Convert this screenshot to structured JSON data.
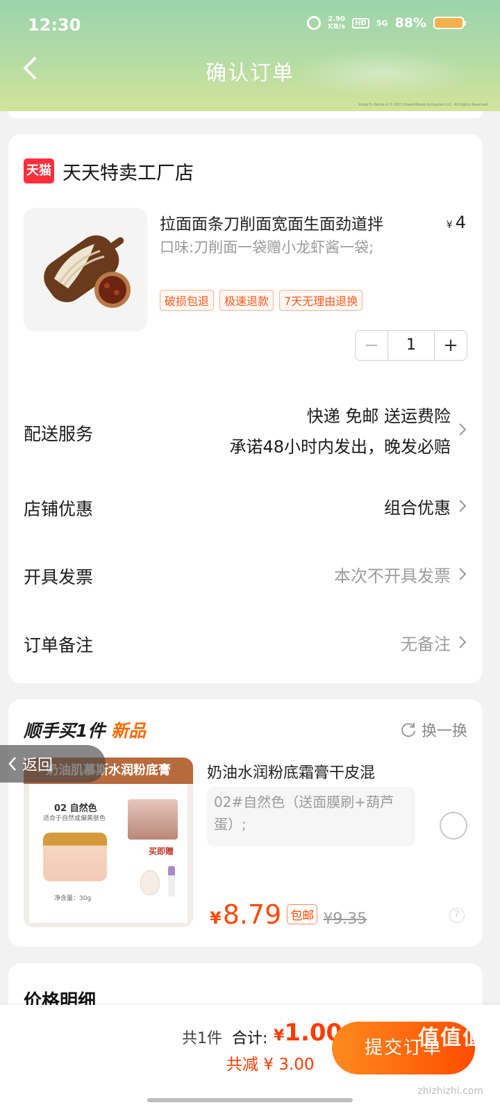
{
  "status_bar": {
    "time": "12:30",
    "speed_value": "2.90",
    "speed_unit": "KB/s",
    "hd": "HD",
    "network": "5G",
    "battery": "88%"
  },
  "header": {
    "title": "确认订单",
    "copyright": "Kung Fu Panda 4 © 2023 DreamWorks Animation LLC. All Rights Reserved."
  },
  "shop": {
    "logo_text": "天猫",
    "name": "天天特卖工厂店",
    "product": {
      "title": "拉面面条刀削面宽面生面劲道拌",
      "price_currency": "¥",
      "price": "4",
      "spec": "口味:刀削面一袋赠小龙虾酱一袋;",
      "tags": [
        "破损包退",
        "极速退款",
        "7天无理由退换"
      ],
      "quantity": "1"
    },
    "rows": {
      "delivery": {
        "label": "配送服务",
        "value_line1": "快递 免邮 送运费险",
        "value_line2": "承诺48小时内发出，晚发必赔"
      },
      "discount": {
        "label": "店铺优惠",
        "value": "组合优惠"
      },
      "invoice": {
        "label": "开具发票",
        "value": "本次不开具发票"
      },
      "note": {
        "label": "订单备注",
        "value": "无备注"
      }
    }
  },
  "recommend": {
    "title": "顺手买1件",
    "title_highlight": "新品",
    "swap_label": "换一换",
    "image_banner": "奶油肌慕斯水润粉底膏",
    "image_shade": "02 自然色",
    "image_shade_note": "适合于自然或偏黄肤色",
    "image_gift_label": "买即赠",
    "image_net": "净含量：30g",
    "product_name": "奶油水润粉底霜膏干皮混",
    "spec": "02#自然色（送面膜刷+葫芦蛋）;",
    "price_currency": "¥",
    "price": "8.79",
    "badge": "包邮",
    "original_price": "¥9.35"
  },
  "back_float": {
    "label": "返回"
  },
  "price_detail": {
    "title": "价格明细"
  },
  "bottom_bar": {
    "count": "共1件",
    "total_label": "合计:",
    "total_currency": "¥",
    "total": "1.00",
    "discount": "共减 ¥ 3.00",
    "submit": "提交订单",
    "watermark": "值值值",
    "watermark_url": "zhizhizhi.com"
  },
  "colors": {
    "accent": "#ff4a00",
    "header_green": "#a7d8a9"
  }
}
